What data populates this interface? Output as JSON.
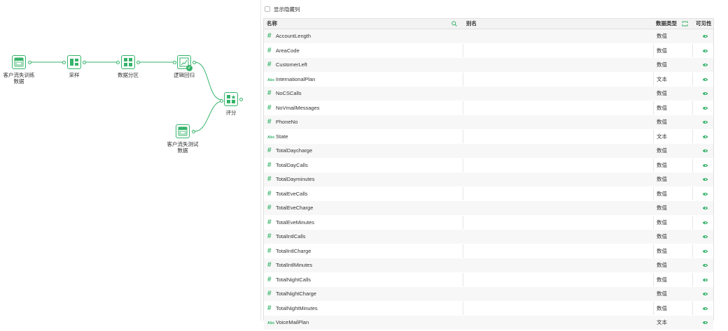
{
  "flow": {
    "nodes": [
      {
        "id": "n1",
        "label": "客户流失训练\n数据",
        "icon": "table-data-icon"
      },
      {
        "id": "n2",
        "label": "采样",
        "icon": "sample-icon"
      },
      {
        "id": "n3",
        "label": "数据分区",
        "icon": "partition-icon"
      },
      {
        "id": "n4",
        "label": "逻辑回归",
        "icon": "logistic-regression-icon"
      },
      {
        "id": "n5",
        "label": "评分",
        "icon": "score-icon"
      },
      {
        "id": "n6",
        "label": "客户流失测试\n数据",
        "icon": "table-data-icon"
      }
    ],
    "accent": "#35b36a"
  },
  "panel": {
    "show_hidden_label": "显示隐藏列",
    "columns": {
      "name": "名称",
      "alias": "别名",
      "datatype": "数据类型",
      "visible": "可见性"
    },
    "rows": [
      {
        "type": "num",
        "name": "AccountLength",
        "datatype": "数值"
      },
      {
        "type": "num",
        "name": "AreaCode",
        "datatype": "数值"
      },
      {
        "type": "num",
        "name": "CustomerLeft",
        "datatype": "数值"
      },
      {
        "type": "txt",
        "name": "InternationalPlan",
        "datatype": "文本"
      },
      {
        "type": "num",
        "name": "NoCSCalls",
        "datatype": "数值"
      },
      {
        "type": "num",
        "name": "NoVmailMessages",
        "datatype": "数值"
      },
      {
        "type": "num",
        "name": "PhoneNo",
        "datatype": "数值"
      },
      {
        "type": "txt",
        "name": "State",
        "datatype": "文本"
      },
      {
        "type": "num",
        "name": "TotalDaycharge",
        "datatype": "数值"
      },
      {
        "type": "num",
        "name": "TotalDayCalls",
        "datatype": "数值"
      },
      {
        "type": "num",
        "name": "TotalDayminutes",
        "datatype": "数值"
      },
      {
        "type": "num",
        "name": "TotalEveCalls",
        "datatype": "数值"
      },
      {
        "type": "num",
        "name": "TotalEveCharge",
        "datatype": "数值"
      },
      {
        "type": "num",
        "name": "TotalEveMinutes",
        "datatype": "数值"
      },
      {
        "type": "num",
        "name": "TotalIntlCalls",
        "datatype": "数值"
      },
      {
        "type": "num",
        "name": "TotalIntlCharge",
        "datatype": "数值"
      },
      {
        "type": "num",
        "name": "TotalIntlMinutes",
        "datatype": "数值"
      },
      {
        "type": "num",
        "name": "TotalNightCalls",
        "datatype": "数值"
      },
      {
        "type": "num",
        "name": "TotalNightCharge",
        "datatype": "数值"
      },
      {
        "type": "num",
        "name": "TotalNightMinutes",
        "datatype": "数值"
      },
      {
        "type": "txt",
        "name": "VoiceMailPlan",
        "datatype": "文本"
      }
    ],
    "type_icon_num": "#",
    "type_icon_txt": "Abc"
  }
}
